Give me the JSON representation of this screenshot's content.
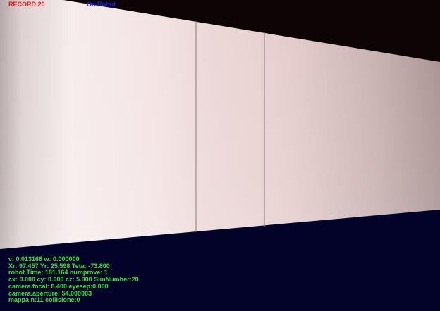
{
  "hud": {
    "record_label": "RECORD 20",
    "status_label": "On Robot",
    "record_color": "#e01010",
    "status_color": "#1a1aff"
  },
  "telemetry": {
    "color": "#39e639",
    "lines": [
      "v: 0.013166 w: 0.000000",
      "Xr: 97.457 Yr: 25.598 Teta: -73.800",
      "robot.Time: 181.164 numprove: 1",
      "cx: 0.000 cy: 0.000 cz: 5.000 SimNumber:20",
      "camera.focal: 8.400 eyesep:0.000",
      "camera.aperture: 54.000003",
      "mappa n:11 collisione:0"
    ]
  },
  "colors": {
    "sky": "#0d0505",
    "floor": "#03032a"
  }
}
